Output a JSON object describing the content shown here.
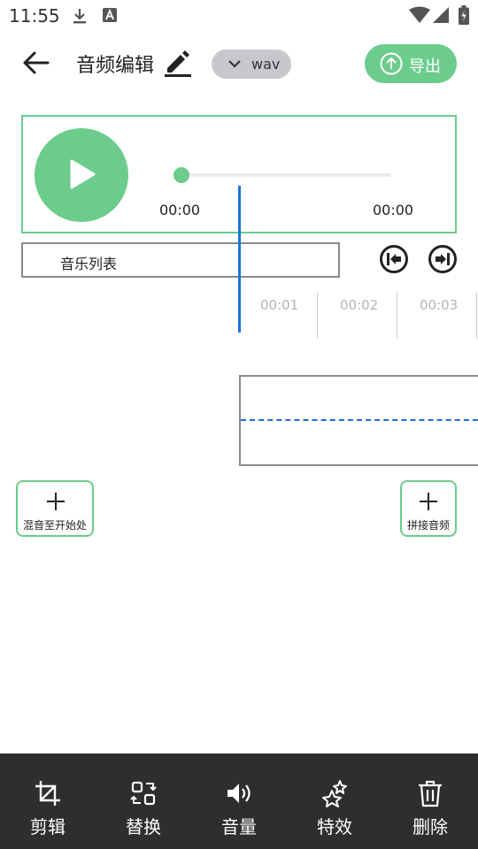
{
  "status_bar": {
    "time": "11:55",
    "icons": [
      "download-icon",
      "text-notification-icon",
      "wifi-icon",
      "signal-icon",
      "battery-icon"
    ]
  },
  "header": {
    "title": "音频编辑",
    "format": "wav",
    "export_label": "导出"
  },
  "player": {
    "current_time": "00:00",
    "total_time": "00:00",
    "progress": 0
  },
  "music_list_label": "音乐列表",
  "timeline": {
    "labels": [
      "00:01",
      "00:02",
      "00:03"
    ]
  },
  "side_buttons": {
    "mix_label": "混音至开始处",
    "concat_label": "拼接音频"
  },
  "toolbar": {
    "items": [
      {
        "label": "剪辑",
        "icon": "crop-icon"
      },
      {
        "label": "替换",
        "icon": "replace-icon"
      },
      {
        "label": "音量",
        "icon": "volume-icon"
      },
      {
        "label": "特效",
        "icon": "effects-icon"
      },
      {
        "label": "删除",
        "icon": "delete-icon"
      }
    ]
  },
  "colors": {
    "accent": "#6ccc8c",
    "playhead": "#1875e0",
    "toolbar_bg": "#2e2e2e",
    "dropdown_bg": "#c6c8cc"
  }
}
